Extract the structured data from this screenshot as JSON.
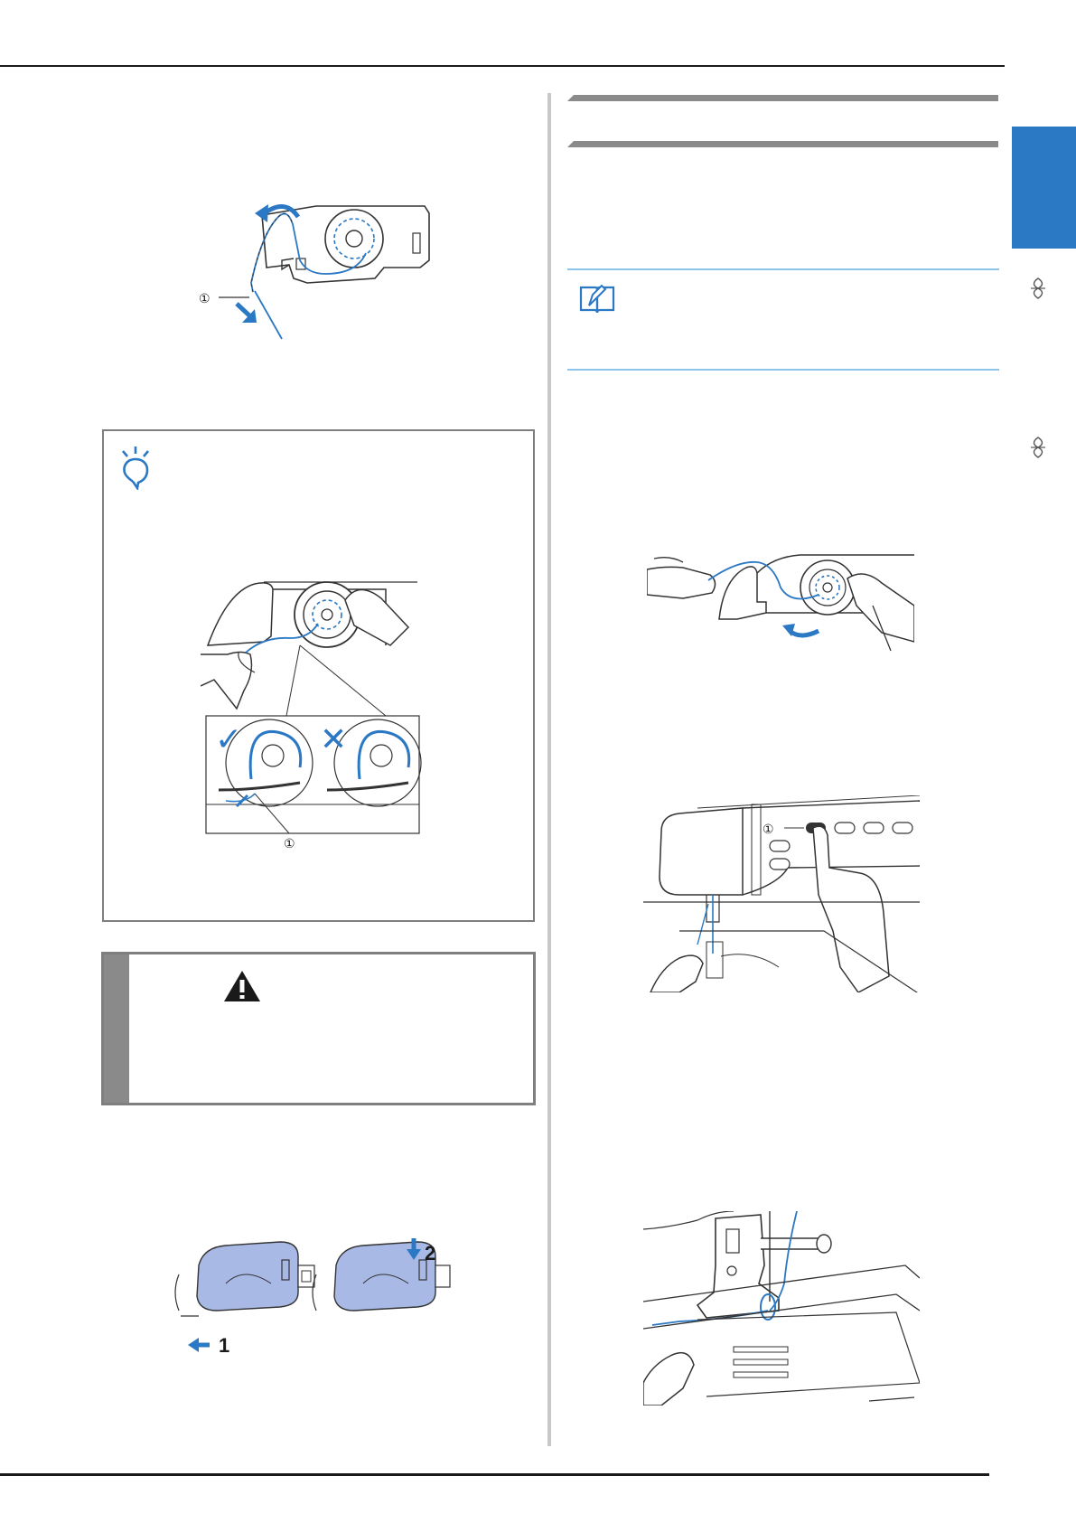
{
  "callouts": {
    "c1": "①",
    "step1": "1",
    "step2": "2"
  },
  "marks": {
    "correct": "✓",
    "incorrect": "✕"
  },
  "icons": {
    "note": "note-lightbulb-icon",
    "memo": "memo-book-icon",
    "warning": "warning-triangle-icon"
  },
  "colors": {
    "thread_blue": "#2b78c4",
    "side_tab": "#2b78c4",
    "bobbin_cover": "#a9b9e6",
    "divider_line": "#8cc4ec"
  }
}
